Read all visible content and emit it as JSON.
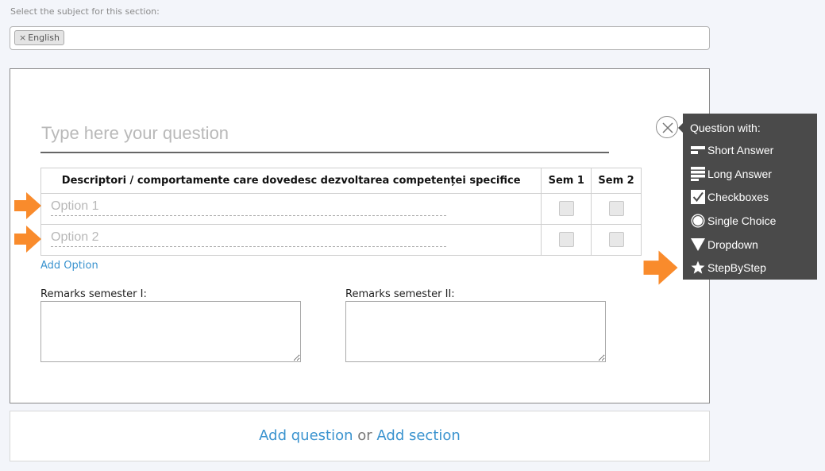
{
  "subject": {
    "label": "Select the subject for this section:",
    "tag_remove": "×",
    "tag": "English"
  },
  "question": {
    "placeholder": "Type here your question",
    "table": {
      "headers": [
        "Descriptori / comportamente care dovedesc dezvoltarea competenței specifice",
        "Sem 1",
        "Sem 2"
      ],
      "rows": [
        {
          "placeholder": "Option 1"
        },
        {
          "placeholder": "Option 2"
        }
      ]
    },
    "add_option": "Add Option",
    "remarks": [
      {
        "label": "Remarks semester I:"
      },
      {
        "label": "Remarks semester II:"
      }
    ]
  },
  "bottom": {
    "add_question": "Add question",
    "or": "or",
    "add_section": "Add section"
  },
  "type_menu": {
    "title": "Question with:",
    "items": [
      {
        "label": "Short Answer",
        "icon": "short-answer-icon"
      },
      {
        "label": "Long Answer",
        "icon": "long-answer-icon"
      },
      {
        "label": "Checkboxes",
        "icon": "checkbox-icon"
      },
      {
        "label": "Single Choice",
        "icon": "radio-icon"
      },
      {
        "label": "Dropdown",
        "icon": "dropdown-triangle-icon"
      },
      {
        "label": "StepByStep",
        "icon": "star-icon"
      }
    ]
  },
  "colors": {
    "link": "#3a93cf",
    "menu_bg": "#4a4a4a",
    "arrow": "#f98b2c"
  }
}
